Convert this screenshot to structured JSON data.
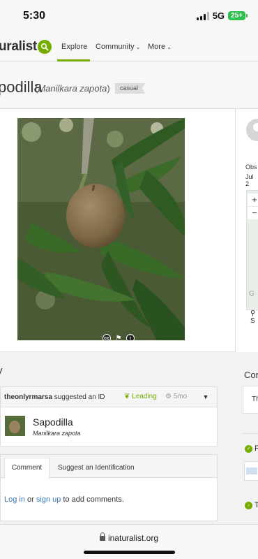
{
  "status": {
    "time": "5:30",
    "network": "5G",
    "battery": "25+"
  },
  "nav": {
    "logo": "uralist",
    "explore": "Explore",
    "community": "Community",
    "more": "More"
  },
  "observation": {
    "common_name": "podilla",
    "scientific_name": "Manilkara zapota",
    "quality_grade": "casual"
  },
  "sidebar": {
    "observer_label": "Obs",
    "date_partial": "Jul 2",
    "map_zoom_in": "+",
    "map_zoom_out": "−",
    "map_g": "G",
    "location_partial": "S"
  },
  "activity": {
    "title": "y",
    "identification": {
      "user": "theonlyrmarsa",
      "action": " suggested an ID",
      "status": "Leading",
      "age": "5mo",
      "taxon_common": "Sapodilla",
      "taxon_scientific": "Manilkara zapota"
    },
    "tabs": {
      "comment": "Comment",
      "suggest": "Suggest an Identification"
    },
    "login": {
      "log_in": "Log in",
      "or": " or ",
      "sign_up": "sign up",
      "suffix": " to add comments."
    }
  },
  "side_panel": {
    "heading": "Con",
    "box_text": "Th",
    "f_text": "F",
    "t_text": "T"
  },
  "browser": {
    "url": "inaturalist.org"
  },
  "colors": {
    "accent": "#74ac00",
    "link": "#3b7ab5"
  }
}
